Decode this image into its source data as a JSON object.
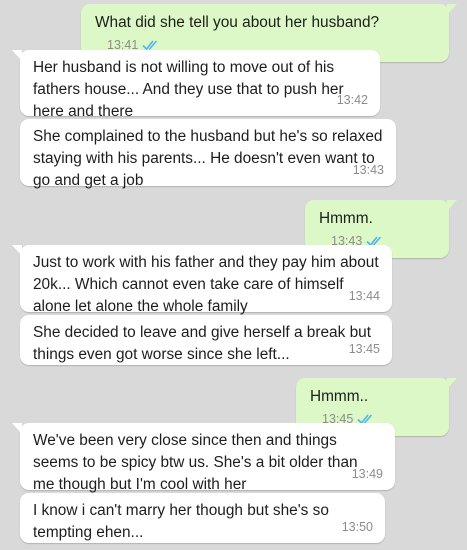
{
  "colors": {
    "background": "#d9d9d9",
    "incoming_bubble": "#ffffff",
    "outgoing_bubble": "#dcf8c6",
    "read_ticks": "#4fb6ec",
    "timestamp": "#8c8c8c"
  },
  "messages": [
    {
      "direction": "outgoing",
      "text": "What did she tell you about her husband?",
      "time": "13:41",
      "status": "read"
    },
    {
      "direction": "incoming",
      "text": "Her husband is not willing to move out of his fathers house... And they use that to push her here and there",
      "time": "13:42"
    },
    {
      "direction": "incoming",
      "text": "She complained to the husband but he's so relaxed staying with his parents... He doesn't even want to go and get a job",
      "time": "13:43"
    },
    {
      "direction": "outgoing",
      "text": "Hmmm.",
      "time": "13:43",
      "status": "read"
    },
    {
      "direction": "incoming",
      "text": "Just to work with his father and they pay him about 20k... Which cannot even take care of himself alone let alone the whole family",
      "time": "13:44"
    },
    {
      "direction": "incoming",
      "text": "She decided to leave and give herself a break but things even got worse since she left...",
      "time": "13:45"
    },
    {
      "direction": "outgoing",
      "text": "Hmmm..",
      "time": "13:45",
      "status": "read"
    },
    {
      "direction": "incoming",
      "text": "We've been very close since then and things seems to be spicy btw us. She's a bit older than me though but I'm cool with her",
      "time": "13:49"
    },
    {
      "direction": "incoming",
      "text": "I know i can't marry her though but she's so tempting ehen...",
      "time": "13:50"
    }
  ]
}
